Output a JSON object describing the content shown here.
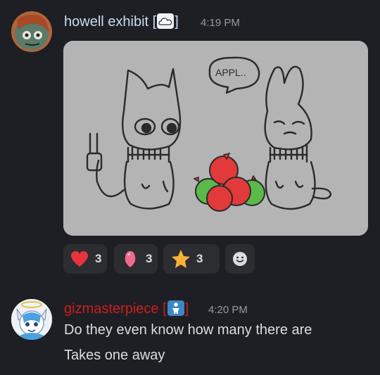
{
  "messages": [
    {
      "username": "howell exhibit",
      "badge_open": "[",
      "badge_close": "]",
      "badge_icon": "cloud-icon",
      "timestamp": "4:19 PM",
      "name_color": "#c9def0",
      "reactions": [
        {
          "emoji": "red-heart-icon",
          "count": "3"
        },
        {
          "emoji": "pink-heart-icon",
          "count": "3"
        },
        {
          "emoji": "star-icon",
          "count": "3"
        }
      ],
      "add_reaction_icon": "smiley-icon",
      "artwork": {
        "speech_text": "APPL..",
        "alt": "two cats looking at a pile of apples"
      }
    },
    {
      "username": "gizmasterpiece",
      "badge_open": "[",
      "badge_close": "]",
      "badge_icon": "baby-symbol-icon",
      "timestamp": "4:20 PM",
      "name_color": "#cc1f1f",
      "lines": [
        "Do they even know how many there are",
        "Takes one away"
      ]
    }
  ]
}
